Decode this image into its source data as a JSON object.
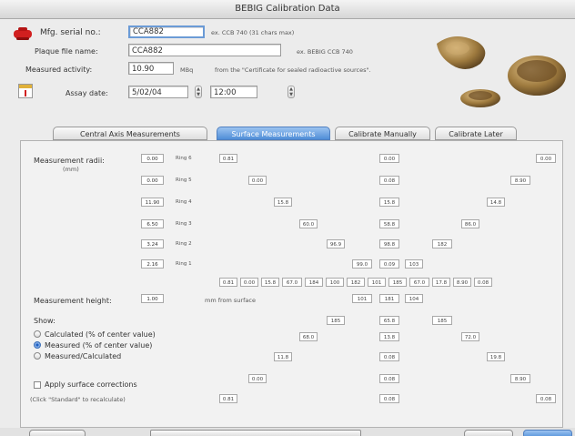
{
  "window": {
    "title": "BEBIG Calibration Data"
  },
  "form": {
    "mfg_label": "Mfg. serial no.:",
    "mfg_value": "CCA882",
    "mfg_hint": "ex. CCB 740 (31 chars max)",
    "file_label": "Plaque file name:",
    "file_value": "CCA882",
    "file_hint": "ex. BEBIG CCB 740",
    "activity_label": "Measured activity:",
    "activity_value": "10.90",
    "activity_unit": "MBq",
    "activity_hint": "from the \"Certificate for sealed radioactive sources\".",
    "assay_label": "Assay date:",
    "assay_date": "5/02/04",
    "assay_time": "12:00"
  },
  "tabs": [
    {
      "label": "Central Axis Measurements",
      "active": false
    },
    {
      "label": "Surface Measurements",
      "active": true
    },
    {
      "label": "Calibrate Manually",
      "active": false
    },
    {
      "label": "Calibrate Later",
      "active": false
    }
  ],
  "panel": {
    "radii_label": "Measurement radii:",
    "radii_unit": "(mm)",
    "radii": [
      {
        "value": "0.00",
        "ring": "Ring 6"
      },
      {
        "value": "0.00",
        "ring": "Ring 5"
      },
      {
        "value": "11.90",
        "ring": "Ring 4"
      },
      {
        "value": "6.50",
        "ring": "Ring 3"
      },
      {
        "value": "3.24",
        "ring": "Ring 2"
      },
      {
        "value": "2.16",
        "ring": "Ring 1"
      }
    ],
    "height_label": "Measurement height:",
    "height_value": "1.00",
    "height_unit": "mm from surface",
    "show_label": "Show:",
    "options": [
      {
        "label": "Calculated (% of center value)",
        "selected": false
      },
      {
        "label": "Measured (% of center value)",
        "selected": true
      },
      {
        "label": "Measured/Calculated",
        "selected": false
      }
    ],
    "apply_label": "Apply surface corrections",
    "apply_note": "(Click \"Standard\" to recalculate)",
    "top_cells": [
      "0.81",
      "0.00",
      "15.8",
      "60.0",
      "96.9",
      "99.0",
      "98.8",
      "182",
      "86.0",
      "14.8",
      "0.00",
      "0.00",
      "0.08",
      "0.09",
      "15.8",
      "58.8",
      "103"
    ],
    "mid_row": [
      "0.81",
      "0.00",
      "15.8",
      "67.0",
      "184",
      "100",
      "182",
      "101",
      "185",
      "67.0",
      "17.8",
      "8.90",
      "0.08"
    ],
    "bottom_cells": [
      "101",
      "181",
      "104",
      "185",
      "65.8",
      "185",
      "68.0",
      "13.8",
      "72.0",
      "11.8",
      "0.08",
      "19.8",
      "0.00",
      "0.08",
      "8.90",
      "0.81",
      "0.08",
      "0.08"
    ]
  },
  "images": {
    "label": "plaques"
  }
}
